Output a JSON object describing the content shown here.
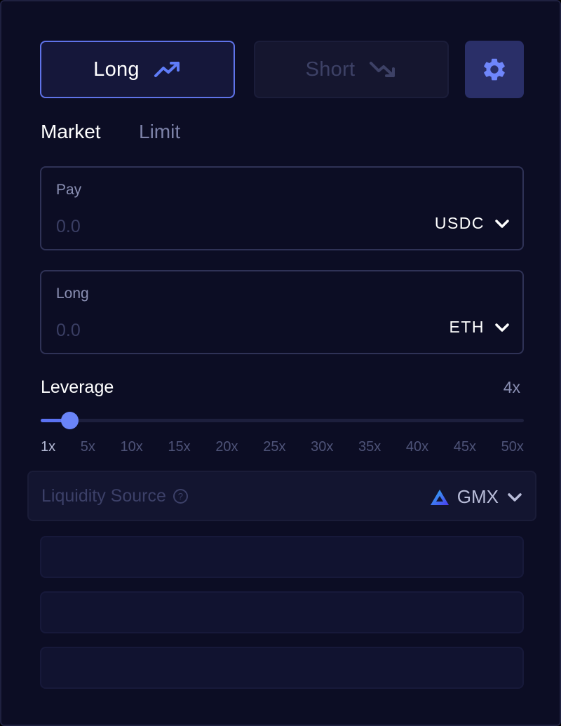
{
  "direction": {
    "long_label": "Long",
    "short_label": "Short",
    "selected": "long"
  },
  "order_tabs": {
    "market_label": "Market",
    "limit_label": "Limit",
    "selected": "market"
  },
  "pay": {
    "label": "Pay",
    "placeholder": "0.0",
    "token": "USDC"
  },
  "long": {
    "label": "Long",
    "placeholder": "0.0",
    "token": "ETH"
  },
  "leverage": {
    "label": "Leverage",
    "value": "4x",
    "slider_fraction": 0.06,
    "ticks": [
      "1x",
      "5x",
      "10x",
      "15x",
      "20x",
      "25x",
      "30x",
      "35x",
      "40x",
      "45x",
      "50x"
    ]
  },
  "liquidity": {
    "label": "Liquidity Source",
    "help": "?",
    "source": "GMX"
  },
  "colors": {
    "accent": "#5f73e8",
    "background": "#0c0d24"
  },
  "icons": [
    "trending-up-icon",
    "trending-down-icon",
    "gear-icon",
    "chevron-down-icon",
    "help-circle-icon",
    "gmx-logo-icon"
  ]
}
